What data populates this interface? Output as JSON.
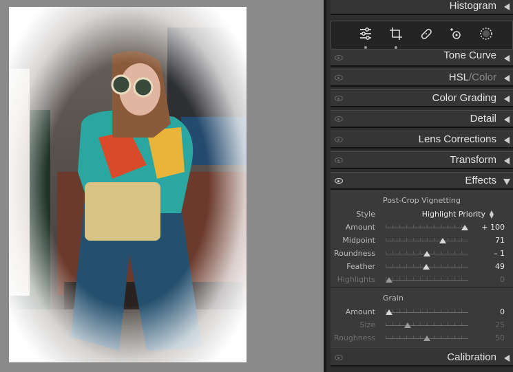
{
  "panels": {
    "histogram": "Histogram",
    "tone_curve": "Tone Curve",
    "hsl": "HSL",
    "hsl_sep": "/",
    "color": "Color",
    "color_grading": "Color Grading",
    "detail": "Detail",
    "lens_corrections": "Lens Corrections",
    "transform": "Transform",
    "effects": "Effects",
    "calibration": "Calibration"
  },
  "tools": [
    "edit-sliders-icon",
    "crop-icon",
    "healing-icon",
    "red-eye-icon",
    "masking-icon"
  ],
  "effects": {
    "vignette_title": "Post-Crop Vignetting",
    "style_label": "Style",
    "style_value": "Highlight Priority",
    "vignette": [
      {
        "label": "Amount",
        "value": "+ 100",
        "pos": 0.96,
        "dim": false
      },
      {
        "label": "Midpoint",
        "value": "71",
        "pos": 0.69,
        "dim": false
      },
      {
        "label": "Roundness",
        "value": "– 1",
        "pos": 0.5,
        "dim": false
      },
      {
        "label": "Feather",
        "value": "49",
        "pos": 0.49,
        "dim": false
      },
      {
        "label": "Highlights",
        "value": "0",
        "pos": 0.04,
        "dim": true
      }
    ],
    "grain_title": "Grain",
    "grain": [
      {
        "label": "Amount",
        "value": "0",
        "pos": 0.04,
        "dim": false
      },
      {
        "label": "Size",
        "value": "25",
        "pos": 0.27,
        "dim": true
      },
      {
        "label": "Roughness",
        "value": "50",
        "pos": 0.5,
        "dim": true
      }
    ]
  },
  "colors": {
    "panel_bg": "#2d2d2d",
    "canvas_bg": "#8a8a8a"
  }
}
